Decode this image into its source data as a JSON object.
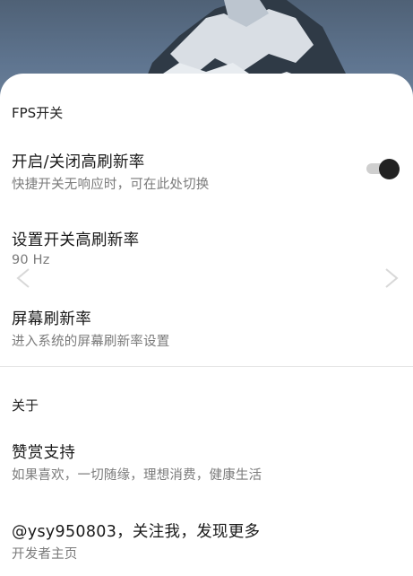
{
  "sections": [
    {
      "title": "FPS开关",
      "items": [
        {
          "title": "开启/关闭高刷新率",
          "subtitle": "快捷开关无响应时，可在此处切换"
        },
        {
          "title": "设置开关高刷新率",
          "subtitle": "90 Hz"
        },
        {
          "title": "屏幕刷新率",
          "subtitle": "进入系统的屏幕刷新率设置"
        }
      ]
    },
    {
      "title": "关于",
      "items": [
        {
          "title": "赞赏支持",
          "subtitle": "如果喜欢，一切随缘，理想消费，健康生活"
        },
        {
          "title": "@ysy950803，关注我，发现更多",
          "subtitle": "开发者主页"
        }
      ]
    }
  ],
  "toggle": {
    "state": "on"
  },
  "icons": {
    "nav_left": "chevron-left-icon",
    "nav_right": "chevron-right-icon"
  }
}
